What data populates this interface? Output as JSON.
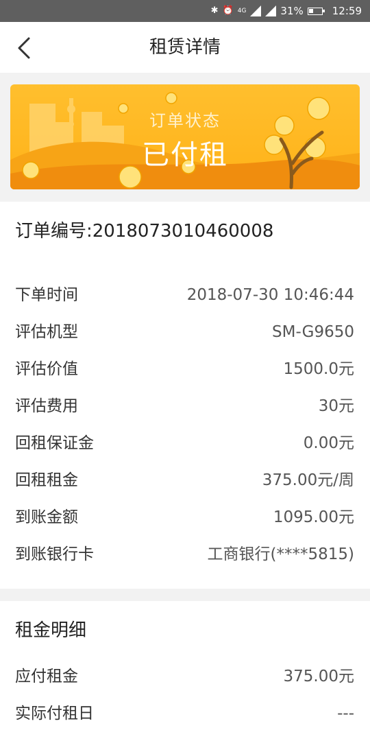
{
  "status_bar": {
    "battery_pct": "31%",
    "time": "12:59",
    "network": "4G",
    "icons": [
      "bluetooth-icon",
      "alarm-icon",
      "signal-icon",
      "battery-icon"
    ]
  },
  "nav": {
    "back_icon": "chevron-left-icon",
    "title": "租赁详情"
  },
  "banner": {
    "label": "订单状态",
    "status": "已付租",
    "colors": {
      "bg": "#ffb218",
      "hill": "#f59a10"
    }
  },
  "order": {
    "number_label": "订单编号:",
    "number": "2018073010460008",
    "rows": [
      {
        "label": "下单时间",
        "value": "2018-07-30 10:46:44"
      },
      {
        "label": "评估机型",
        "value": "SM-G9650"
      },
      {
        "label": "评估价值",
        "value": "1500.0元"
      },
      {
        "label": "评估费用",
        "value": "30元"
      },
      {
        "label": "回租保证金",
        "value": "0.00元"
      },
      {
        "label": "回租租金",
        "value": "375.00元/周"
      },
      {
        "label": "到账金额",
        "value": "1095.00元"
      },
      {
        "label": "到账银行卡",
        "value": "工商银行(****5815)"
      }
    ]
  },
  "rent_detail": {
    "title": "租金明细",
    "rows": [
      {
        "label": "应付租金",
        "value": "375.00元"
      },
      {
        "label": "实际付租日",
        "value": "---"
      }
    ]
  }
}
